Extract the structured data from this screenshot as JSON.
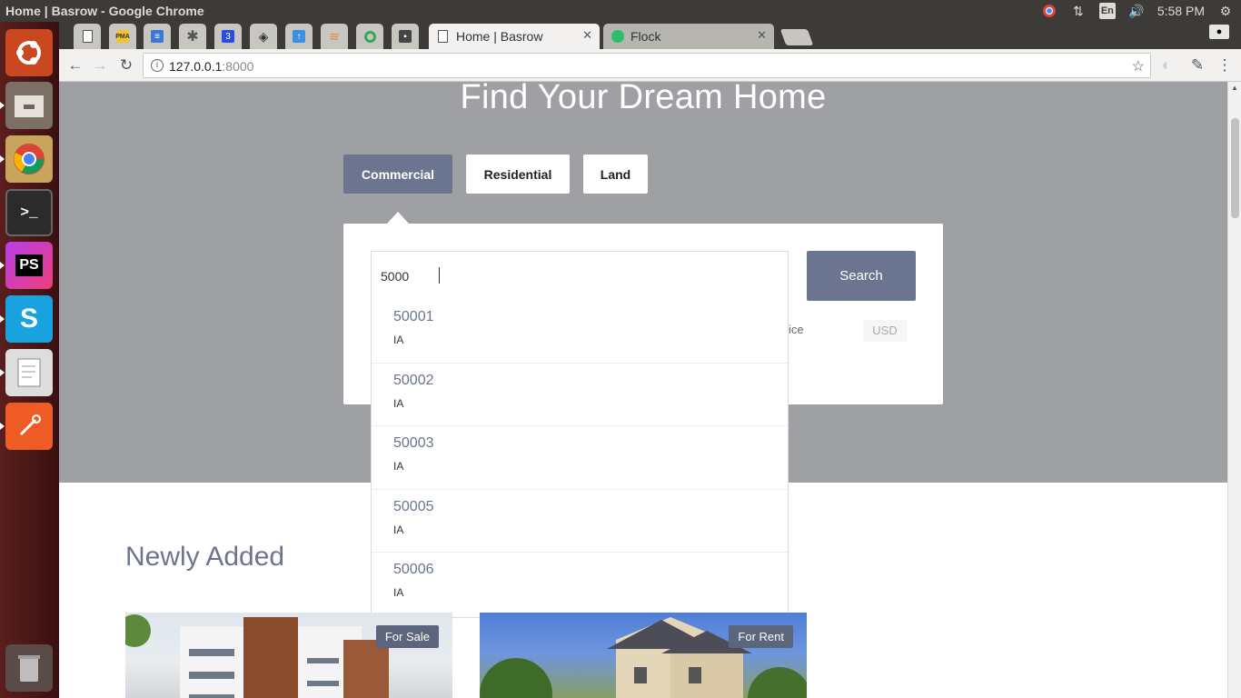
{
  "window": {
    "title": "Home | Basrow - Google Chrome",
    "clock": "5:58 PM",
    "lang": "En"
  },
  "launcher": {
    "items": [
      "ubuntu-icon",
      "files-icon",
      "chrome-icon",
      "terminal-icon",
      "phpstorm-icon",
      "skype-icon",
      "text-editor-icon",
      "postman-icon",
      "trash-icon"
    ]
  },
  "tabs": {
    "pinned": [
      "blank-page-icon",
      "phpmyadmin-icon",
      "database-icon",
      "asterisk-icon",
      "css-icon",
      "diamond-icon",
      "upload-icon",
      "stackoverflow-icon",
      "circle-app-icon",
      "save-icon"
    ],
    "pma_label": "PMA",
    "ps_label": "PS",
    "active": {
      "label": "Home | Basrow"
    },
    "second": {
      "label": "Flock"
    },
    "close": "✕"
  },
  "toolbar": {
    "url_host": "127.0.0.1",
    "url_port": ":8000"
  },
  "hero": {
    "heading": "Find Your Dream Home"
  },
  "property_types": [
    "Commercial",
    "Residential",
    "Land"
  ],
  "search": {
    "value": "5000",
    "button": "Search",
    "price_label": "ice",
    "currency": "USD"
  },
  "suggestions": [
    {
      "zip": "50001",
      "state": "IA"
    },
    {
      "zip": "50002",
      "state": "IA"
    },
    {
      "zip": "50003",
      "state": "IA"
    },
    {
      "zip": "50005",
      "state": "IA"
    },
    {
      "zip": "50006",
      "state": "IA"
    }
  ],
  "newly": {
    "heading": "Newly Added"
  },
  "listings": [
    {
      "badge": "For Sale"
    },
    {
      "badge": "For Rent"
    }
  ],
  "colors": {
    "accent": "#6b7590",
    "hero_bg": "#9fa0a3",
    "launcher_bg": "#4a1b1b"
  }
}
